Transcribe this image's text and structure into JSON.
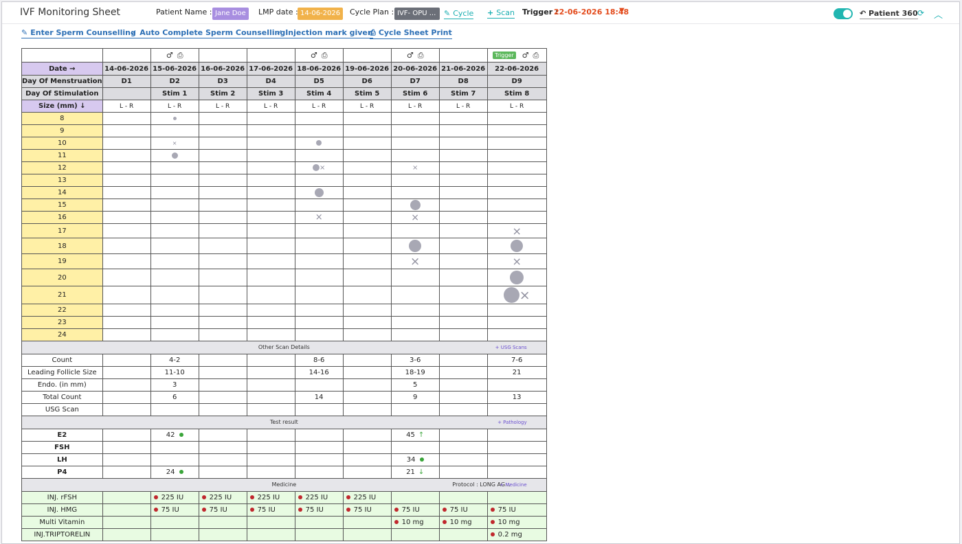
{
  "header": {
    "title": "IVF Monitoring Sheet",
    "patient_label": "Patient Name :",
    "patient_value": "Jane Doe",
    "lmp_label": "LMP date :",
    "lmp_value": "14-06-2026",
    "cycle_plan_label": "Cycle Plan :",
    "cycle_plan_value": "IVF- OPU ...",
    "cycle_link": "Cycle",
    "scan_link": "Scan",
    "trigger_label": "Trigger :",
    "trigger_value": "22-06-2026 18:48",
    "patient360": "Patient 360",
    "colors": {
      "purple_badge": "#a88ee0",
      "orange_badge": "#f1b24a",
      "gray_badge": "#6b6f78",
      "teal": "#1aaeb1"
    }
  },
  "actions": {
    "enter_sperm": "Enter Sperm Counselling",
    "auto_sperm": "Auto Complete Sperm Counselling",
    "injection": "Injection mark given",
    "print": "Cycle Sheet Print"
  },
  "grid": {
    "labels": {
      "date": "Date →",
      "menstruation": "Day Of Menstruation",
      "stimulation": "Day Of Stimulation",
      "size": "Size (mm) ↓"
    },
    "trigger_tag": "Trigger",
    "dates": [
      "14-06-2026",
      "15-06-2026",
      "16-06-2026",
      "17-06-2026",
      "18-06-2026",
      "19-06-2026",
      "20-06-2026",
      "21-06-2026",
      "22-06-2026"
    ],
    "days": [
      "D1",
      "D2",
      "D3",
      "D4",
      "D5",
      "D6",
      "D7",
      "D8",
      "D9"
    ],
    "stims": [
      "",
      "Stim 1",
      "Stim 2",
      "Stim 3",
      "Stim 4",
      "Stim 5",
      "Stim 6",
      "Stim 7",
      "Stim 8"
    ],
    "lr": [
      "L - R",
      "L - R",
      "L - R",
      "L - R",
      "L - R",
      "L - R",
      "L - R",
      "L - R",
      "L - R"
    ],
    "sizes": [
      "8",
      "9",
      "10",
      "11",
      "12",
      "13",
      "14",
      "15",
      "16",
      "17",
      "18",
      "19",
      "20",
      "21",
      "22",
      "23",
      "24"
    ]
  },
  "sections": {
    "other_scan": "Other Scan Details",
    "usg_btn": "USG Scans",
    "test_result": "Test result",
    "pathology_btn": "Pathology",
    "medicine": "Medicine",
    "protocol": "Protocol :  LONG AG...",
    "medicine_btn": "Medicine"
  },
  "scan_rows": [
    {
      "label": "Count",
      "vals": [
        "",
        "4-2",
        "",
        "",
        "8-6",
        "",
        "3-6",
        "",
        "7-6"
      ]
    },
    {
      "label": "Leading Follicle Size",
      "vals": [
        "",
        "11-10",
        "",
        "",
        "14-16",
        "",
        "18-19",
        "",
        "21"
      ]
    },
    {
      "label": "Endo. (in mm)",
      "vals": [
        "",
        "3",
        "",
        "",
        "",
        "",
        "5",
        "",
        ""
      ]
    },
    {
      "label": "Total Count",
      "vals": [
        "",
        "6",
        "",
        "",
        "14",
        "",
        "9",
        "",
        "13"
      ]
    },
    {
      "label": "USG Scan",
      "vals": [
        "",
        "",
        "",
        "",
        "",
        "",
        "",
        "",
        ""
      ]
    }
  ],
  "test_rows": [
    {
      "label": "E2",
      "vals": [
        "",
        "42",
        "",
        "",
        "",
        "",
        "45",
        "",
        ""
      ]
    },
    {
      "label": "FSH",
      "vals": [
        "",
        "",
        "",
        "",
        "",
        "",
        "",
        "",
        ""
      ]
    },
    {
      "label": "LH",
      "vals": [
        "",
        "",
        "",
        "",
        "",
        "",
        "34",
        "",
        ""
      ]
    },
    {
      "label": "P4",
      "vals": [
        "",
        "24",
        "",
        "",
        "",
        "",
        "21",
        "",
        ""
      ]
    }
  ],
  "med_rows": [
    {
      "label": "INJ. rFSH",
      "vals": [
        "",
        "225 IU",
        "225 IU",
        "225 IU",
        "225 IU",
        "225 IU",
        "",
        "",
        ""
      ]
    },
    {
      "label": "INJ. HMG",
      "vals": [
        "",
        "75 IU",
        "75 IU",
        "75 IU",
        "75 IU",
        "75 IU",
        "75 IU",
        "75 IU",
        "75 IU"
      ]
    },
    {
      "label": "Multi Vitamin",
      "vals": [
        "",
        "",
        "",
        "",
        "",
        "",
        "10 mg",
        "10 mg",
        "10 mg"
      ]
    },
    {
      "label": "INJ.TRIPTORELIN",
      "vals": [
        "",
        "",
        "",
        "",
        "",
        "",
        "",
        "",
        "0.2 mg"
      ]
    }
  ]
}
